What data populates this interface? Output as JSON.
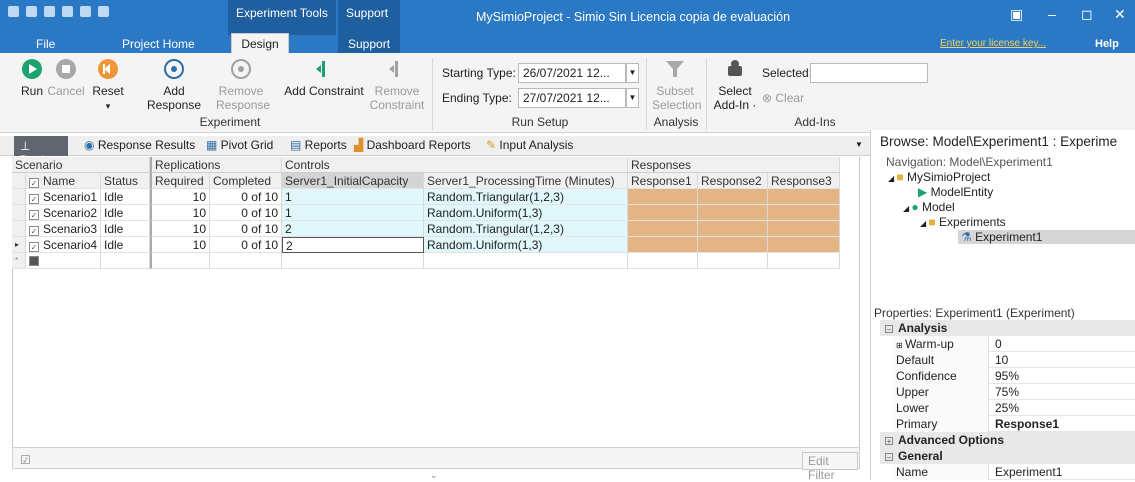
{
  "window": {
    "title": "MySimioProject - Simio Sin Licencia copia de evaluación",
    "license_link": "Enter your license key...",
    "help": "Help"
  },
  "context_tabs": {
    "experiment_tools": "Experiment Tools",
    "support": "Support"
  },
  "menu": {
    "file": "File",
    "project_home": "Project Home",
    "design": "Design",
    "support": "Support"
  },
  "ribbon": {
    "run": "Run",
    "cancel": "Cancel",
    "reset": "Reset",
    "add_response": "Add Response",
    "remove_response_1": "Remove",
    "remove_response_2": "Response",
    "add_constraint": "Add Constraint",
    "remove_constraint_1": "Remove",
    "remove_constraint_2": "Constraint",
    "starting_type_label": "Starting Type:",
    "starting_type_value": "26/07/2021 12...",
    "ending_type_label": "Ending Type:",
    "ending_type_value": "27/07/2021 12...",
    "subset_selection_1": "Subset",
    "subset_selection_2": "Selection",
    "select_addin_1": "Select",
    "select_addin_2": "Add-In ·",
    "selected_label": "Selected:",
    "clear": "Clear",
    "group_experiment": "Experiment",
    "group_run_setup": "Run Setup",
    "group_analysis": "Analysis",
    "group_addins": "Add-Ins"
  },
  "view_tabs": [
    "Design",
    "Response Results",
    "Pivot Grid",
    "Reports",
    "Dashboard Reports",
    "Input Analysis"
  ],
  "grid": {
    "groups": {
      "scenario": "Scenario",
      "replications": "Replications",
      "controls": "Controls",
      "responses": "Responses"
    },
    "columns": [
      "Name",
      "Status",
      "Required",
      "Completed",
      "Server1_InitialCapacity",
      "Server1_ProcessingTime (Minutes)",
      "Response1",
      "Response2",
      "Response3"
    ],
    "rows": [
      {
        "name": "Scenario1",
        "status": "Idle",
        "required": "10",
        "completed": "0 of 10",
        "capacity": "1",
        "processing": "Random.Triangular(1,2,3)"
      },
      {
        "name": "Scenario2",
        "status": "Idle",
        "required": "10",
        "completed": "0 of 10",
        "capacity": "1",
        "processing": "Random.Uniform(1,3)"
      },
      {
        "name": "Scenario3",
        "status": "Idle",
        "required": "10",
        "completed": "0 of 10",
        "capacity": "2",
        "processing": "Random.Triangular(1,2,3)"
      },
      {
        "name": "Scenario4",
        "status": "Idle",
        "required": "10",
        "completed": "0 of 10",
        "capacity": "2",
        "processing": "Random.Uniform(1,3)"
      }
    ],
    "edit_filter": "Edit Filter"
  },
  "browse": {
    "title": "Browse: Model\\Experiment1 : Experime",
    "navigation": "Navigation: Model\\Experiment1",
    "tree": [
      "MySimioProject",
      "ModelEntity",
      "Model",
      "Experiments",
      "Experiment1"
    ]
  },
  "properties": {
    "title": "Properties: Experiment1 (Experiment)",
    "cat_analysis": "Analysis",
    "rows": [
      {
        "name": "Warm-up Per...",
        "value": "0"
      },
      {
        "name": "Default Replica...",
        "value": "10"
      },
      {
        "name": "Confidence Level",
        "value": "95%"
      },
      {
        "name": "Upper Percentile",
        "value": "75%"
      },
      {
        "name": "Lower Percentile",
        "value": "25%"
      },
      {
        "name": "Primary Respo...",
        "value": "Response1"
      }
    ],
    "cat_advanced": "Advanced Options",
    "cat_general": "General",
    "name_label": "Name",
    "name_value": "Experiment1"
  },
  "colors": {
    "title_bar": "#2b78c4",
    "context_tab": "#1f5f9f",
    "control_cell": "#e0f7fb",
    "response_cell": "#e3b584"
  }
}
